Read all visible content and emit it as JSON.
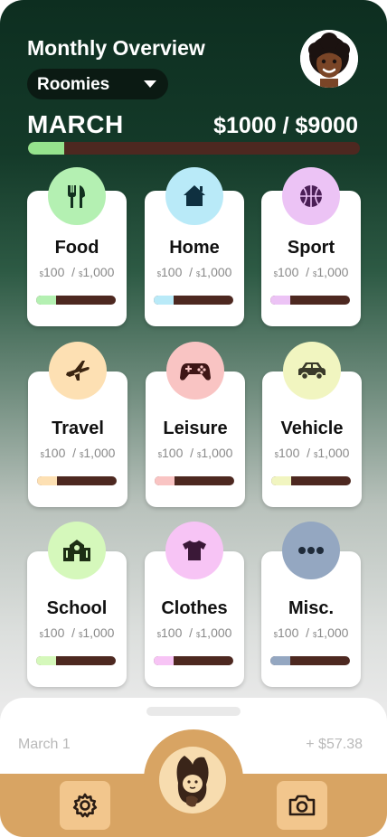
{
  "header": {
    "title": "Monthly Overview",
    "group": "Roomies",
    "month": "MARCH",
    "budget": "$1000 / $9000",
    "progress": 0.11
  },
  "colors": {
    "progress_fill": "#95e38d",
    "track": "#4d2820",
    "nav_accent": "#d8a463"
  },
  "categories": [
    {
      "name": "Food",
      "icon": "fork-knife-icon",
      "spent": "100",
      "limit": "1,000",
      "color": "#b4f0b2",
      "progress": 0.25
    },
    {
      "name": "Home",
      "icon": "house-icon",
      "spent": "100",
      "limit": "1,000",
      "color": "#b9eaf8",
      "progress": 0.25
    },
    {
      "name": "Sport",
      "icon": "basketball-icon",
      "spent": "100",
      "limit": "1,000",
      "color": "#ecc3f5",
      "progress": 0.25
    },
    {
      "name": "Travel",
      "icon": "airplane-icon",
      "spent": "100",
      "limit": "1,000",
      "color": "#fde0b3",
      "progress": 0.25
    },
    {
      "name": "Leisure",
      "icon": "gamepad-icon",
      "spent": "100",
      "limit": "1,000",
      "color": "#f9c4c3",
      "progress": 0.25
    },
    {
      "name": "Vehicle",
      "icon": "car-icon",
      "spent": "100",
      "limit": "1,000",
      "color": "#f1f5c0",
      "progress": 0.25
    },
    {
      "name": "School",
      "icon": "school-icon",
      "spent": "100",
      "limit": "1,000",
      "color": "#d5f8bb",
      "progress": 0.25
    },
    {
      "name": "Clothes",
      "icon": "shirt-icon",
      "spent": "100",
      "limit": "1,000",
      "color": "#f7c4f5",
      "progress": 0.25
    },
    {
      "name": "Misc.",
      "icon": "more-dots-icon",
      "spent": "100",
      "limit": "1,000",
      "color": "#94a7c1",
      "progress": 0.25
    }
  ],
  "sheet": {
    "date": "March 1",
    "amount": "+ $57.38"
  },
  "nav": {
    "left_icon": "gear-icon",
    "center_icon": "mascot-icon",
    "right_icon": "camera-icon"
  }
}
